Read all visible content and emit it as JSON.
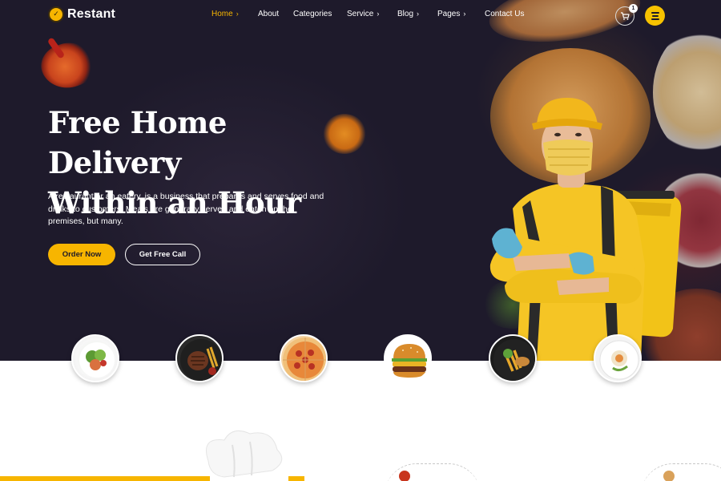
{
  "brand": {
    "name": "Restant",
    "accent": "#f7b500",
    "dark": "#1d1929"
  },
  "nav": {
    "items": [
      {
        "label": "Home",
        "active": true,
        "has_dropdown": true
      },
      {
        "label": "About",
        "active": false,
        "has_dropdown": false
      },
      {
        "label": "Categories",
        "active": false,
        "has_dropdown": false
      },
      {
        "label": "Service",
        "active": false,
        "has_dropdown": true
      },
      {
        "label": "Blog",
        "active": false,
        "has_dropdown": true
      },
      {
        "label": "Pages",
        "active": false,
        "has_dropdown": true
      },
      {
        "label": "Contact Us",
        "active": false,
        "has_dropdown": false
      }
    ],
    "cart_count": "1",
    "icons": {
      "cart": "cart-icon",
      "menu": "hamburger-icon",
      "dropdown": "chevron-right-icon"
    }
  },
  "hero": {
    "title_line1": "Free Home Delivery",
    "title_line2": "Within an Hour",
    "description": "A restaurant or an eatery, is a business that prepares and serves food and drinks to customers. Meals are generally served and eaten on the premises, but many.",
    "primary_button": "Order Now",
    "secondary_button": "Get Free Call"
  },
  "categories": [
    {
      "name": "salad-plate"
    },
    {
      "name": "steak-plate"
    },
    {
      "name": "pizza"
    },
    {
      "name": "burger"
    },
    {
      "name": "fish-and-chips"
    },
    {
      "name": "dessert-plate"
    }
  ]
}
